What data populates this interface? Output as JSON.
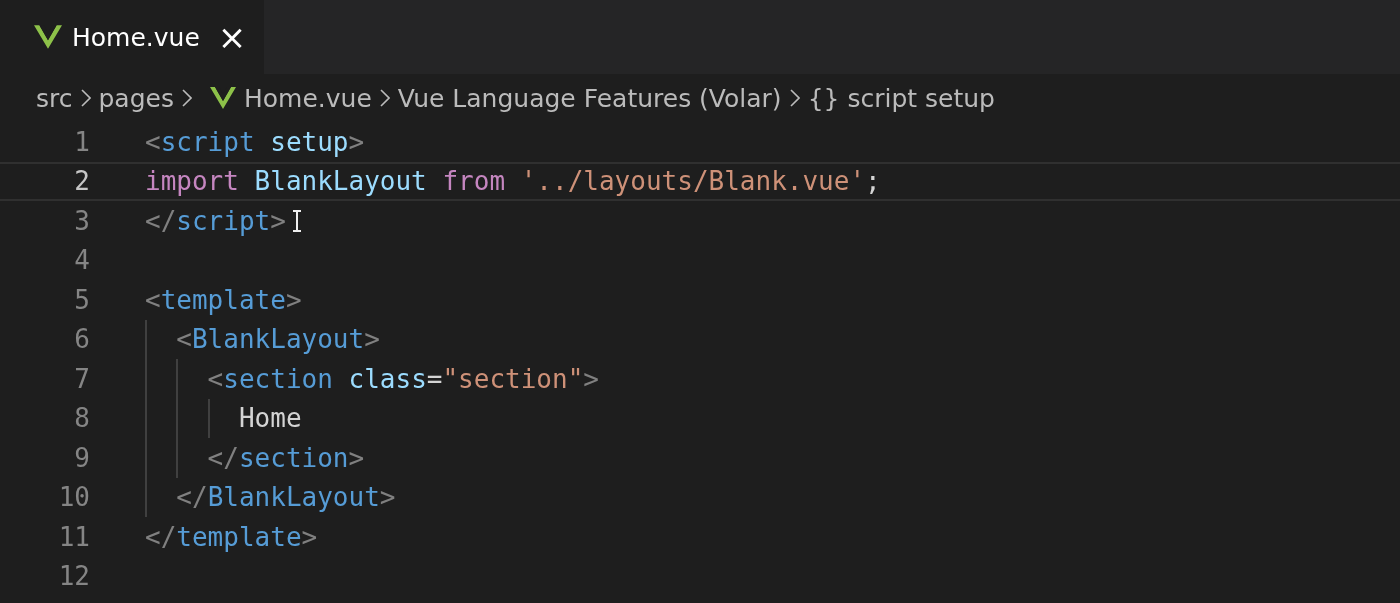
{
  "tabs": [
    {
      "kind": "vue",
      "label": "Home.vue",
      "selected": true,
      "close": "×"
    }
  ],
  "breadcrumbs": [
    {
      "kind": "plain",
      "label": "src"
    },
    {
      "kind": "plain",
      "label": "pages"
    },
    {
      "kind": "vue",
      "label": "Home.vue"
    },
    {
      "kind": "plain",
      "label": "Vue Language Features (Volar)"
    },
    {
      "kind": "braces",
      "icon": "{}",
      "label": "script setup"
    }
  ],
  "lines": [
    {
      "number": "1",
      "current": false,
      "tokens": [
        {
          "kind": "punct",
          "text": "<"
        },
        {
          "kind": "tag",
          "text": "script "
        },
        {
          "kind": "attr",
          "text": "setup"
        },
        {
          "kind": "punct",
          "text": ">"
        }
      ]
    },
    {
      "number": "2",
      "current": true,
      "tokens": [
        {
          "kind": "keyword",
          "text": "import "
        },
        {
          "kind": "var",
          "text": "BlankLayout "
        },
        {
          "kind": "keyword",
          "text": "from "
        },
        {
          "kind": "string",
          "text": "'../layouts/Blank.vue'"
        },
        {
          "kind": "plain",
          "text": ";"
        }
      ]
    },
    {
      "number": "3",
      "current": false,
      "pointer": true,
      "tokens": [
        {
          "kind": "punct",
          "text": "</"
        },
        {
          "kind": "tag",
          "text": "script"
        },
        {
          "kind": "punct",
          "text": ">"
        }
      ]
    },
    {
      "number": "4",
      "current": false
    },
    {
      "number": "5",
      "current": false,
      "tokens": [
        {
          "kind": "punct",
          "text": "<"
        },
        {
          "kind": "tag",
          "text": "template"
        },
        {
          "kind": "punct",
          "text": ">"
        }
      ]
    },
    {
      "number": "6",
      "current": false,
      "tokens": [
        {
          "kind": "punct",
          "text": "  <"
        },
        {
          "kind": "tag",
          "text": "BlankLayout"
        },
        {
          "kind": "punct",
          "text": ">"
        }
      ]
    },
    {
      "number": "7",
      "current": false,
      "tokens": [
        {
          "kind": "punct",
          "text": "    <"
        },
        {
          "kind": "tag",
          "text": "section "
        },
        {
          "kind": "attr",
          "text": "class"
        },
        {
          "kind": "plain",
          "text": "="
        },
        {
          "kind": "string",
          "text": "\"section\""
        },
        {
          "kind": "punct",
          "text": ">"
        }
      ]
    },
    {
      "number": "8",
      "current": false,
      "tokens": [
        {
          "kind": "plain",
          "text": "      Home"
        }
      ]
    },
    {
      "number": "9",
      "current": false,
      "tokens": [
        {
          "kind": "punct",
          "text": "    </"
        },
        {
          "kind": "tag",
          "text": "section"
        },
        {
          "kind": "punct",
          "text": ">"
        }
      ]
    },
    {
      "number": "10",
      "current": false,
      "tokens": [
        {
          "kind": "punct",
          "text": "  </"
        },
        {
          "kind": "tag",
          "text": "BlankLayout"
        },
        {
          "kind": "punct",
          "text": ">"
        }
      ]
    },
    {
      "number": "11",
      "current": false,
      "tokens": [
        {
          "kind": "punct",
          "text": "</"
        },
        {
          "kind": "tag",
          "text": "template"
        },
        {
          "kind": "punct",
          "text": ">"
        }
      ]
    },
    {
      "number": "12",
      "current": false
    }
  ]
}
